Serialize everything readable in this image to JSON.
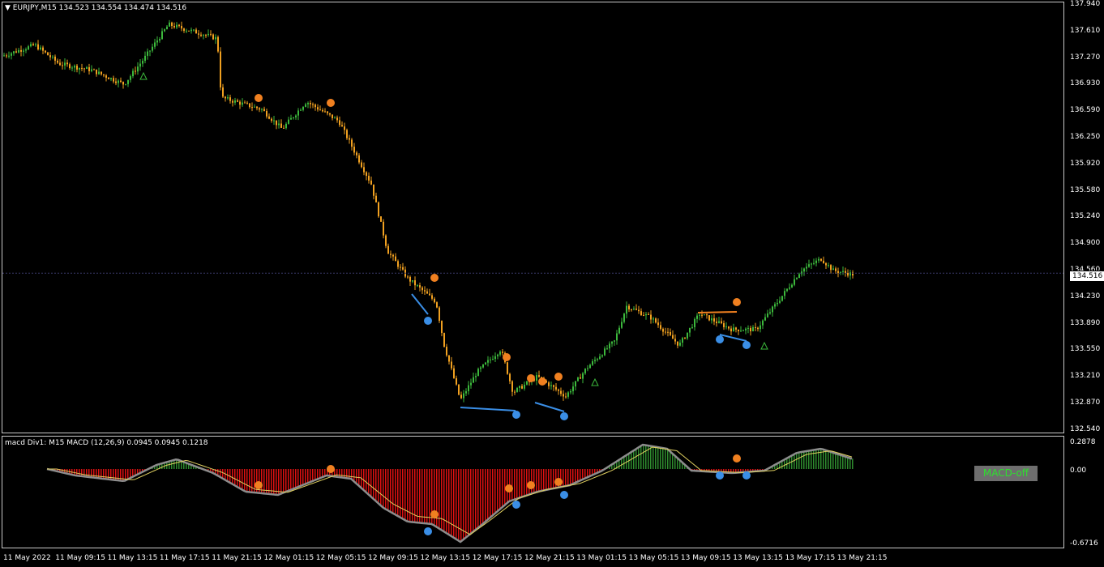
{
  "main": {
    "title": "EURJPY,M15  134.523 134.554 134.474 134.516",
    "price_tag": "134.516",
    "yticks": [
      "137.940",
      "137.610",
      "137.270",
      "136.930",
      "136.590",
      "136.250",
      "135.920",
      "135.580",
      "135.240",
      "134.900",
      "134.560",
      "134.230",
      "133.890",
      "133.550",
      "133.210",
      "132.870",
      "132.540"
    ]
  },
  "sub": {
    "title": "macd Div1: M15 MACD (12,26,9) 0.0945 0.0945 0.1218",
    "yticks": [
      "0.2878",
      "0.00",
      "-0.6716"
    ],
    "button_label": "MACD-off"
  },
  "xaxis": [
    "11 May 2022",
    "11 May 09:15",
    "11 May 13:15",
    "11 May 17:15",
    "11 May 21:15",
    "12 May 01:15",
    "12 May 05:15",
    "12 May 09:15",
    "12 May 13:15",
    "12 May 17:15",
    "12 May 21:15",
    "13 May 01:15",
    "13 May 05:15",
    "13 May 09:15",
    "13 May 13:15",
    "13 May 17:15",
    "13 May 21:15"
  ],
  "colors": {
    "bull": "#3cb83c",
    "bear": "#f0a020",
    "hist_pos": "#2e8b2e",
    "hist_neg": "#dd1111",
    "macd_line": "#8c8c8c",
    "signal_line": "#e0d060",
    "div_low": "#3a8ee6",
    "div_high": "#f08020"
  }
}
